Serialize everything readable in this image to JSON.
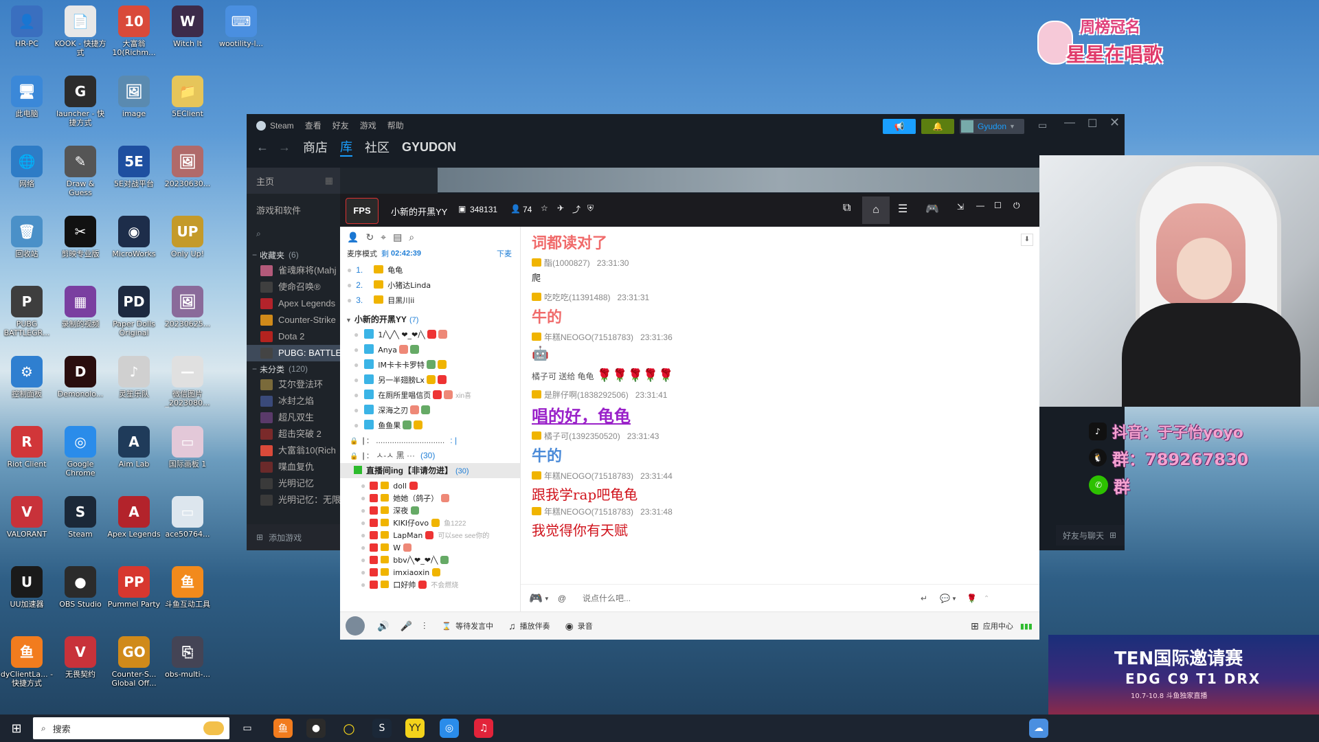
{
  "desktop": {
    "icons": [
      {
        "label": "HR-PC",
        "color": "#3a6fbf",
        "glyph": "👤"
      },
      {
        "label": "KOOK - 快捷方式",
        "color": "#e8e8e8",
        "glyph": "📄"
      },
      {
        "label": "大富翁10(Richm...",
        "color": "#d94a3a",
        "glyph": "10"
      },
      {
        "label": "Witch It",
        "color": "#3d2b4a",
        "glyph": "W"
      },
      {
        "label": "wootility-l...",
        "color": "#4a8fe0",
        "glyph": "⌨"
      },
      {
        "label": "此电脑",
        "color": "#3b88d8",
        "glyph": "🖥"
      },
      {
        "label": "launcher - 快捷方式",
        "color": "#2c2c2c",
        "glyph": "G"
      },
      {
        "label": "image",
        "color": "#5a8ab0",
        "glyph": "🖼"
      },
      {
        "label": "5EClient",
        "color": "#e6c55a",
        "glyph": "📁"
      },
      {
        "label": "网络",
        "color": "#2e7cc6",
        "glyph": "🌐"
      },
      {
        "label": "Draw & Guess",
        "color": "#555",
        "glyph": "✎"
      },
      {
        "label": "5E对战平台",
        "color": "#1e4fa0",
        "glyph": "5E"
      },
      {
        "label": "20230630...",
        "color": "#b06a6a",
        "glyph": "🖼"
      },
      {
        "label": "回收站",
        "color": "#4a90c8",
        "glyph": "🗑"
      },
      {
        "label": "剪映专业版",
        "color": "#111",
        "glyph": "✂"
      },
      {
        "label": "MicroWorks",
        "color": "#1d2d4a",
        "glyph": "◉"
      },
      {
        "label": "Only Up!",
        "color": "#c49a2a",
        "glyph": "UP"
      },
      {
        "label": "PUBG BATTLEGR...",
        "color": "#3e3e3e",
        "glyph": "P"
      },
      {
        "label": "录制的视频",
        "color": "#7a3fa0",
        "glyph": "▦"
      },
      {
        "label": "Paper Dolls Original",
        "color": "#1d2940",
        "glyph": "PD"
      },
      {
        "label": "20230625...",
        "color": "#8a6a9a",
        "glyph": "🖼"
      },
      {
        "label": "控制面板",
        "color": "#2f7fd0",
        "glyph": "⚙"
      },
      {
        "label": "Demonolo...",
        "color": "#2a0e0e",
        "glyph": "D"
      },
      {
        "label": "灵笙乐队",
        "color": "#d0d0d0",
        "glyph": "♪"
      },
      {
        "label": "微信图片_2023080...",
        "color": "#e0e0e0",
        "glyph": "—"
      },
      {
        "label": "Riot Client",
        "color": "#d13639",
        "glyph": "R"
      },
      {
        "label": "Google Chrome",
        "color": "#2a8cea",
        "glyph": "◎"
      },
      {
        "label": "Aim Lab",
        "color": "#1f3b5a",
        "glyph": "A"
      },
      {
        "label": "国际画板 1",
        "color": "#e3c8d8",
        "glyph": "▭"
      },
      {
        "label": "VALORANT",
        "color": "#c8323a",
        "glyph": "V"
      },
      {
        "label": "Steam",
        "color": "#1b2838",
        "glyph": "S"
      },
      {
        "label": "Apex Legends",
        "color": "#b3232b",
        "glyph": "A"
      },
      {
        "label": "ace50764...",
        "color": "#dde6ee",
        "glyph": "▭"
      },
      {
        "label": "UU加速器",
        "color": "#1a1a1a",
        "glyph": "U"
      },
      {
        "label": "OBS Studio",
        "color": "#2b2b2b",
        "glyph": "●"
      },
      {
        "label": "Pummel Party",
        "color": "#d7372f",
        "glyph": "PP"
      },
      {
        "label": "斗鱼互动工具",
        "color": "#f28a1c",
        "glyph": "鱼"
      },
      {
        "label": "dyClientLa... - 快捷方式",
        "color": "#f27c1e",
        "glyph": "鱼"
      },
      {
        "label": "无畏契约",
        "color": "#c8323a",
        "glyph": "V"
      },
      {
        "label": "Counter-S... Global Off...",
        "color": "#d08a1a",
        "glyph": "GO"
      },
      {
        "label": "obs-multi-...",
        "color": "#445",
        "glyph": "⎘"
      }
    ],
    "top_right_logo": {
      "line1": "周榜冠名",
      "line2": "星星在唱歌"
    },
    "stream_overlay": {
      "douyin": "抖音：于子怡yoyo",
      "qq_group": "群：789267830",
      "wechat": "群"
    },
    "ad_banner": {
      "title": "TEN国际邀请赛",
      "teams": "EDG C9 T1 DRX",
      "dates": "10.7-10.8 斗鱼独家直播"
    }
  },
  "steam": {
    "menu": [
      "Steam",
      "查看",
      "好友",
      "游戏",
      "帮助"
    ],
    "nav": [
      "商店",
      "库",
      "社区",
      "GYUDON"
    ],
    "nav_active_index": 1,
    "user_name": "Gyudon",
    "home_label": "主页",
    "filter_label": "游戏和软件",
    "favorites_header": "收藏夹",
    "favorites_count": "(6)",
    "favorites": [
      {
        "name": "雀魂麻将(Mahj",
        "color": "#b35a7a"
      },
      {
        "name": "使命召唤®",
        "color": "#3f3f3f"
      },
      {
        "name": "Apex Legends",
        "color": "#b3232b"
      },
      {
        "name": "Counter-Strike",
        "color": "#d08a1a"
      },
      {
        "name": "Dota 2",
        "color": "#b3231f"
      },
      {
        "name": "PUBG: BATTLE",
        "color": "#444"
      }
    ],
    "uncategorized_header": "未分类",
    "uncategorized_count": "(120)",
    "uncategorized": [
      {
        "name": "艾尔登法环",
        "color": "#7a6a3a"
      },
      {
        "name": "冰封之焰",
        "color": "#3a4a7a"
      },
      {
        "name": "超凡双生",
        "color": "#5a3a6a"
      },
      {
        "name": "超击突破 2",
        "color": "#7a2a2a"
      },
      {
        "name": "大富翁10(Rich",
        "color": "#d94a3a"
      },
      {
        "name": "喋血复仇",
        "color": "#6a2a2a"
      },
      {
        "name": "光明记忆",
        "color": "#3a3a3a"
      },
      {
        "name": "光明记忆：无限",
        "color": "#3a3a3a"
      }
    ],
    "add_game": "添加游戏",
    "friends_chat": "好友与聊天"
  },
  "yy": {
    "channel_name": "小新的开黑YY",
    "channel_id": "348131",
    "online_count": "74",
    "mic_mode": "麦序模式",
    "mic_time_prefix": "剩",
    "mic_time": "02:42:39",
    "mic_down": "下麦",
    "queue": [
      {
        "num": "1.",
        "name": "龟龟"
      },
      {
        "num": "2.",
        "name": "小猪达Linda"
      },
      {
        "num": "3.",
        "name": "目黑川ii"
      }
    ],
    "group_name": "小新的开黑YY",
    "group_count": "(7)",
    "members": [
      {
        "name": "1/╲╱╲ ❤_❤/╲"
      },
      {
        "name": "Anya"
      },
      {
        "name": "IM卡卡卡罗特"
      },
      {
        "name": "另一半翅膀Lx"
      },
      {
        "name": "在厕所里唱信页",
        "extra": "xin喜"
      },
      {
        "name": "深海之刃"
      },
      {
        "name": "鱼鱼果"
      }
    ],
    "sub_rows": [
      {
        "left": "| :",
        "mid": "..............................",
        "right": ": |"
      },
      {
        "left": "| :",
        "mid": "ㅅ-ㅅ     黑      ···",
        "right": "(30)"
      }
    ],
    "live_channel": "直播间ing【非请勿进】",
    "live_count": "(30)",
    "live_members": [
      {
        "name": "doll"
      },
      {
        "name": "她她（鸽子）"
      },
      {
        "name": "深夜"
      },
      {
        "name": "KIKI仔ovo",
        "extra": "鱼1222"
      },
      {
        "name": "LapMan",
        "extra": "可以see see你的"
      },
      {
        "name": "W"
      },
      {
        "name": "bbv/╲❤_❤/╲"
      },
      {
        "name": "imxiaoxin"
      },
      {
        "name": "口好帅",
        "extra": "不会燃烧"
      }
    ],
    "chat": [
      {
        "type": "big",
        "text": "词都读对了",
        "color": "#f06b6b"
      },
      {
        "type": "meta",
        "user": "酯(1000827)",
        "time": "23:31:30"
      },
      {
        "type": "text",
        "text": "爬",
        "color": "#222"
      },
      {
        "type": "meta",
        "user": "吃吃吃(11391488)",
        "time": "23:31:31"
      },
      {
        "type": "big",
        "text": "牛的",
        "color": "#f06b6b"
      },
      {
        "type": "meta",
        "user": "年糕NEOGO(71518783)",
        "time": "23:31:36"
      },
      {
        "type": "emoji",
        "text": "🤖"
      },
      {
        "type": "gift",
        "text": "橘子可 送给 龟龟",
        "emoji": "🌹🌹🌹🌹🌹"
      },
      {
        "type": "meta",
        "user": "是胖仔啊(1838292506)",
        "time": "23:31:41"
      },
      {
        "type": "big-u",
        "text": "唱的好，龟龟",
        "color": "#9a22c9"
      },
      {
        "type": "meta",
        "user": "橘子可(1392350520)",
        "time": "23:31:43"
      },
      {
        "type": "big",
        "text": "牛的",
        "color": "#4a8ad8"
      },
      {
        "type": "meta",
        "user": "年糕NEOGO(71518783)",
        "time": "23:31:44"
      },
      {
        "type": "serif",
        "text": "跟我学rap吧龟龟",
        "color": "#d0121b"
      },
      {
        "type": "meta",
        "user": "年糕NEOGO(71518783)",
        "time": "23:31:48"
      },
      {
        "type": "serif",
        "text": "我觉得你有天赋",
        "color": "#d0121b"
      }
    ],
    "input_placeholder": "说点什么吧...",
    "bottom": {
      "wait": "等待发言中",
      "music": "播放伴奏",
      "record": "录音",
      "apps": "应用中心"
    }
  },
  "taskbar": {
    "search_placeholder": "搜索"
  },
  "colors": {
    "steam_bg": "#171d25",
    "steam_accent": "#1a9fff",
    "yy_dark": "#1b1b1f",
    "chat_red": "#d0121b"
  }
}
